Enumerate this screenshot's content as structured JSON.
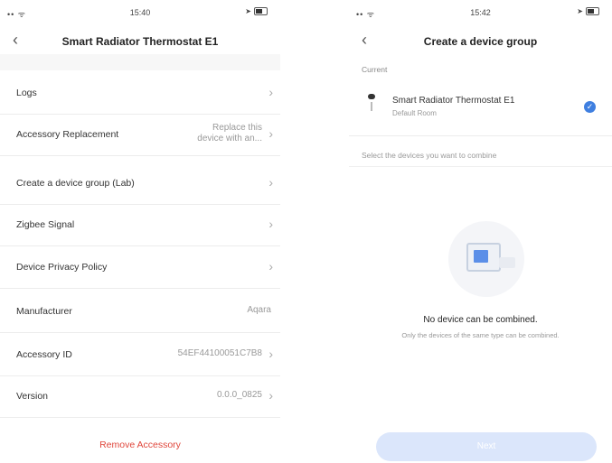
{
  "left": {
    "status": {
      "signal": "•• ᯤ",
      "time": "15:40"
    },
    "title": "Smart Radiator Thermostat E1",
    "back_glyph": "‹",
    "rows": [
      {
        "label": "Logs",
        "value": ""
      },
      {
        "label": "Accessory Replacement",
        "value": "Replace this device with an..."
      },
      {
        "label": "Create a device group (Lab)",
        "value": ""
      },
      {
        "label": "Zigbee Signal",
        "value": ""
      },
      {
        "label": "Device Privacy Policy",
        "value": ""
      },
      {
        "label": "Manufacturer",
        "value": "Aqara"
      },
      {
        "label": "Accessory ID",
        "value": "54EF44100051C7B8"
      },
      {
        "label": "Version",
        "value": "0.0.0_0825"
      }
    ],
    "remove_label": "Remove Accessory",
    "chevron": "›"
  },
  "right": {
    "status": {
      "signal": "•• ᯤ",
      "time": "15:42"
    },
    "title": "Create a device group",
    "back_glyph": "‹",
    "current_label": "Current",
    "device": {
      "name": "Smart Radiator Thermostat E1",
      "room": "Default Room"
    },
    "check_glyph": "✓",
    "select_hint": "Select the devices you want to combine",
    "empty_title": "No device can be combined.",
    "empty_sub": "Only the devices of the same type can be combined.",
    "next_label": "Next"
  },
  "colors": {
    "accent": "#3f7fe0",
    "danger": "#e0473c",
    "next_disabled": "#dbe6fb"
  }
}
